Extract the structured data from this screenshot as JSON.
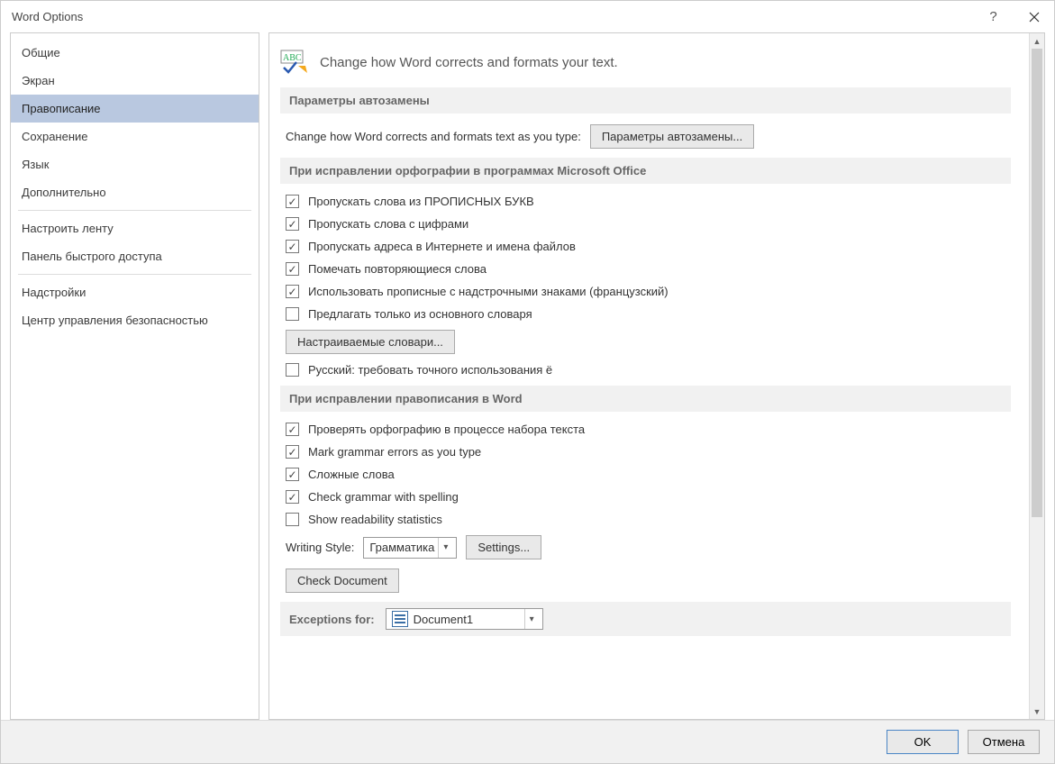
{
  "window": {
    "title": "Word Options"
  },
  "sidebar": {
    "items": [
      {
        "label": "Общие",
        "selected": false
      },
      {
        "label": "Экран",
        "selected": false
      },
      {
        "label": "Правописание",
        "selected": true
      },
      {
        "label": "Сохранение",
        "selected": false
      },
      {
        "label": "Язык",
        "selected": false
      },
      {
        "label": "Дополнительно",
        "selected": false
      },
      {
        "label": "Настроить ленту",
        "selected": false,
        "sep_before": true
      },
      {
        "label": "Панель быстрого доступа",
        "selected": false
      },
      {
        "label": "Надстройки",
        "selected": false,
        "sep_before": true
      },
      {
        "label": "Центр управления безопасностью",
        "selected": false
      }
    ]
  },
  "main": {
    "header": "Change how Word corrects and formats your text.",
    "section1": {
      "title": "Параметры автозамены",
      "text": "Change how Word corrects and formats text as you type:",
      "button": "Параметры автозамены..."
    },
    "section2": {
      "title": "При исправлении орфографии в программах Microsoft Office",
      "checks": [
        {
          "label": "Пропускать слова из ПРОПИСНЫХ БУКВ",
          "checked": true
        },
        {
          "label": "Пропускать слова с цифрами",
          "checked": true
        },
        {
          "label": "Пропускать адреса в Интернете и имена файлов",
          "checked": true
        },
        {
          "label": "Помечать повторяющиеся слова",
          "checked": true
        },
        {
          "label": "Использовать прописные с надстрочными знаками (французский)",
          "checked": true
        },
        {
          "label": "Предлагать только из основного словаря",
          "checked": false
        }
      ],
      "button": "Настраиваемые словари...",
      "check_extra": {
        "label": "Русский: требовать точного использования ё",
        "checked": false
      }
    },
    "section3": {
      "title": "При исправлении правописания в Word",
      "checks": [
        {
          "label": "Проверять орфографию в процессе набора текста",
          "checked": true
        },
        {
          "label": "Mark grammar errors as you type",
          "checked": true
        },
        {
          "label": "Сложные слова",
          "checked": true
        },
        {
          "label": "Check grammar with spelling",
          "checked": true
        },
        {
          "label": "Show readability statistics",
          "checked": false
        }
      ],
      "writing_style_label": "Writing Style:",
      "writing_style_value": "Грамматика",
      "settings_button": "Settings...",
      "check_doc_button": "Check Document"
    },
    "section4": {
      "title": "Exceptions for:",
      "doc_value": "Document1"
    }
  },
  "footer": {
    "ok": "OK",
    "cancel": "Отмена"
  }
}
